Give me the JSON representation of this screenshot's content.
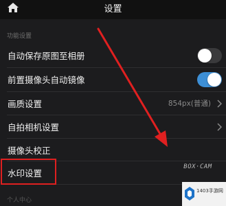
{
  "header": {
    "title": "设置"
  },
  "section": {
    "label": "功能设置"
  },
  "rows": [
    {
      "label": "自动保存原图至相册",
      "toggle": "off"
    },
    {
      "label": "前置摄像头自动镜像",
      "toggle": "on"
    },
    {
      "label": "画质设置",
      "value": "854px(普通)"
    },
    {
      "label": "自拍相机设置"
    },
    {
      "label": "摄像头校正"
    },
    {
      "label": "水印设置"
    }
  ],
  "watermark_preview": "BOX·CAM",
  "next_section": {
    "label": "个人中心"
  },
  "badge": {
    "text": "1403手游网"
  },
  "colors": {
    "background": "#1c1c1e",
    "toggle_on": "#3d8fd6",
    "highlight": "#e02020"
  }
}
